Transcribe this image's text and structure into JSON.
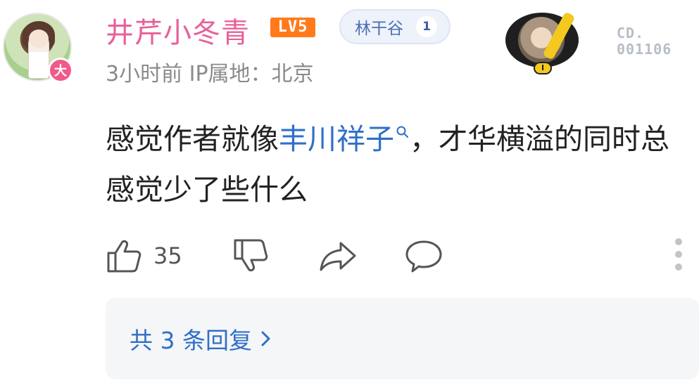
{
  "user": {
    "name": "井芹小冬青",
    "level_badge": "LV5",
    "avatar_badge": "大",
    "meta": "3小时前 IP属地：北京"
  },
  "forum_tag": {
    "name": "林干谷",
    "level": "1"
  },
  "decoration": {
    "serial_line1": "CD.",
    "serial_line2": "001106",
    "medal": "I"
  },
  "comment": {
    "before": "感觉作者就像",
    "highlight": "丰川祥子",
    "after": "，才华横溢的同时总感觉少了些什么"
  },
  "actions": {
    "like_count": "35"
  },
  "replies": {
    "label": "共 3 条回复"
  },
  "colors": {
    "username": "#e8609a",
    "level": "#ff7a1a",
    "link": "#2f6fc8",
    "meta": "#8a8a8a"
  }
}
